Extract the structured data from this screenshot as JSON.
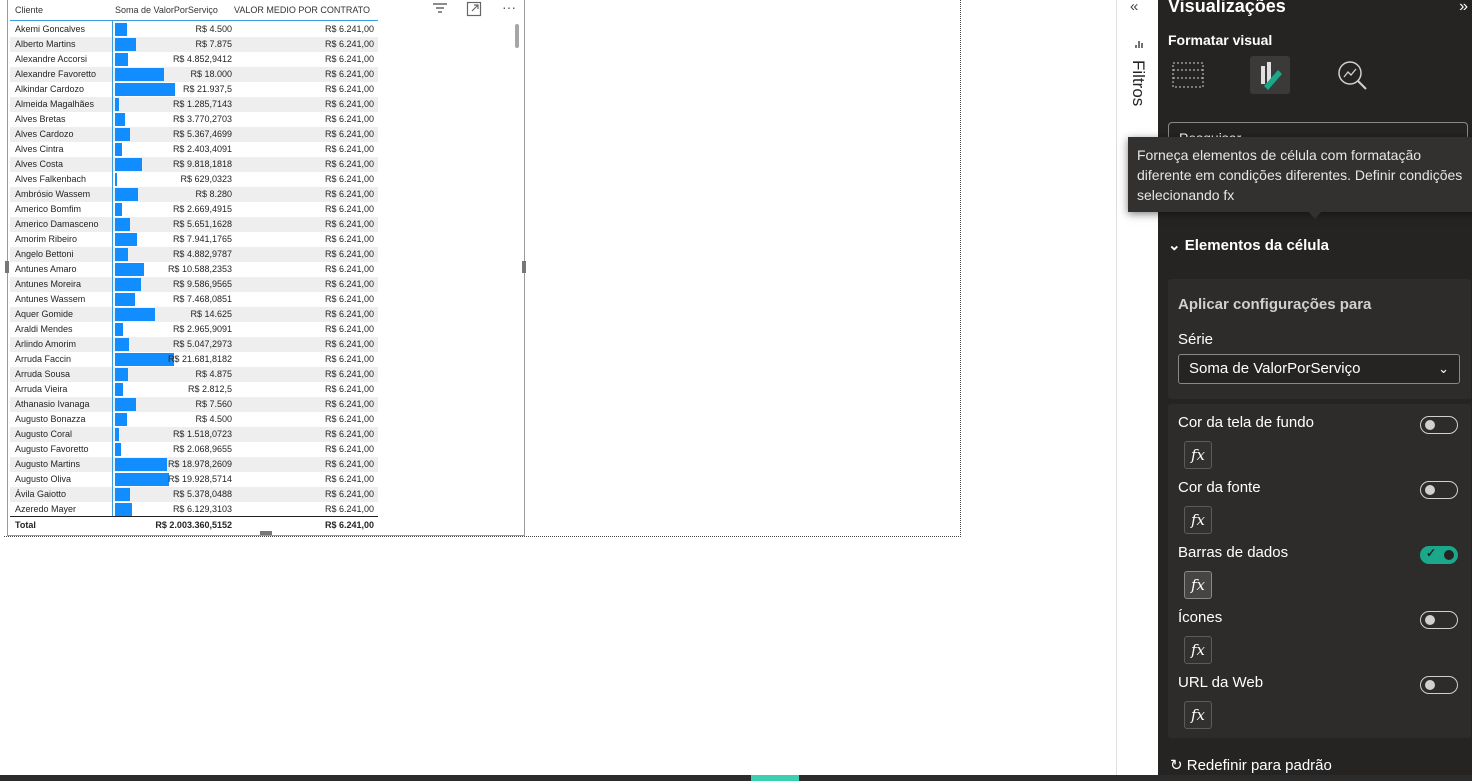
{
  "table": {
    "headers": {
      "cliente": "Cliente",
      "soma": "Soma de ValorPorServiço",
      "medio": "VALOR MEDIO POR CONTRATO"
    },
    "rows": [
      {
        "name": "Akemi Goncalves",
        "value": "R$ 4.500",
        "avg": "R$ 6.241,00",
        "bar": 4500
      },
      {
        "name": "Alberto Martins",
        "value": "R$ 7.875",
        "avg": "R$ 6.241,00",
        "bar": 7875
      },
      {
        "name": "Alexandre Accorsi",
        "value": "R$ 4.852,9412",
        "avg": "R$ 6.241,00",
        "bar": 4853
      },
      {
        "name": "Alexandre Favoretto",
        "value": "R$ 18.000",
        "avg": "R$ 6.241,00",
        "bar": 18000
      },
      {
        "name": "Alkindar Cardozo",
        "value": "R$ 21.937,5",
        "avg": "R$ 6.241,00",
        "bar": 21938
      },
      {
        "name": "Almeida Magalhães",
        "value": "R$ 1.285,7143",
        "avg": "R$ 6.241,00",
        "bar": 1286
      },
      {
        "name": "Alves Bretas",
        "value": "R$ 3.770,2703",
        "avg": "R$ 6.241,00",
        "bar": 3770
      },
      {
        "name": "Alves Cardozo",
        "value": "R$ 5.367,4699",
        "avg": "R$ 6.241,00",
        "bar": 5367
      },
      {
        "name": "Alves Cintra",
        "value": "R$ 2.403,4091",
        "avg": "R$ 6.241,00",
        "bar": 2403
      },
      {
        "name": "Alves Costa",
        "value": "R$ 9.818,1818",
        "avg": "R$ 6.241,00",
        "bar": 9818
      },
      {
        "name": "Alves Falkenbach",
        "value": "R$ 629,0323",
        "avg": "R$ 6.241,00",
        "bar": 629
      },
      {
        "name": "Ambrósio Wassem",
        "value": "R$ 8.280",
        "avg": "R$ 6.241,00",
        "bar": 8280
      },
      {
        "name": "Americo Bomfim",
        "value": "R$ 2.669,4915",
        "avg": "R$ 6.241,00",
        "bar": 2669
      },
      {
        "name": "Americo Damasceno",
        "value": "R$ 5.651,1628",
        "avg": "R$ 6.241,00",
        "bar": 5651
      },
      {
        "name": "Amorim Ribeiro",
        "value": "R$ 7.941,1765",
        "avg": "R$ 6.241,00",
        "bar": 7941
      },
      {
        "name": "Angelo Bettoni",
        "value": "R$ 4.882,9787",
        "avg": "R$ 6.241,00",
        "bar": 4883
      },
      {
        "name": "Antunes Amaro",
        "value": "R$ 10.588,2353",
        "avg": "R$ 6.241,00",
        "bar": 10588
      },
      {
        "name": "Antunes Moreira",
        "value": "R$ 9.586,9565",
        "avg": "R$ 6.241,00",
        "bar": 9587
      },
      {
        "name": "Antunes Wassem",
        "value": "R$ 7.468,0851",
        "avg": "R$ 6.241,00",
        "bar": 7468
      },
      {
        "name": "Aquer Gomide",
        "value": "R$ 14.625",
        "avg": "R$ 6.241,00",
        "bar": 14625
      },
      {
        "name": "Araldi Mendes",
        "value": "R$ 2.965,9091",
        "avg": "R$ 6.241,00",
        "bar": 2966
      },
      {
        "name": "Arlindo Amorim",
        "value": "R$ 5.047,2973",
        "avg": "R$ 6.241,00",
        "bar": 5047
      },
      {
        "name": "Arruda Faccin",
        "value": "R$ 21.681,8182",
        "avg": "R$ 6.241,00",
        "bar": 21682
      },
      {
        "name": "Arruda Sousa",
        "value": "R$ 4.875",
        "avg": "R$ 6.241,00",
        "bar": 4875
      },
      {
        "name": "Arruda Vieira",
        "value": "R$ 2.812,5",
        "avg": "R$ 6.241,00",
        "bar": 2813
      },
      {
        "name": "Athanasio Ivanaga",
        "value": "R$ 7.560",
        "avg": "R$ 6.241,00",
        "bar": 7560
      },
      {
        "name": "Augusto Bonazza",
        "value": "R$ 4.500",
        "avg": "R$ 6.241,00",
        "bar": 4500
      },
      {
        "name": "Augusto Coral",
        "value": "R$ 1.518,0723",
        "avg": "R$ 6.241,00",
        "bar": 1518
      },
      {
        "name": "Augusto Favoretto",
        "value": "R$ 2.068,9655",
        "avg": "R$ 6.241,00",
        "bar": 2069
      },
      {
        "name": "Augusto Martins",
        "value": "R$ 18.978,2609",
        "avg": "R$ 6.241,00",
        "bar": 18978
      },
      {
        "name": "Augusto Oliva",
        "value": "R$ 19.928,5714",
        "avg": "R$ 6.241,00",
        "bar": 19929
      },
      {
        "name": "Ávila Gaiotto",
        "value": "R$ 5.378,0488",
        "avg": "R$ 6.241,00",
        "bar": 5378
      },
      {
        "name": "Azeredo Mayer",
        "value": "R$ 6.129,3103",
        "avg": "R$ 6.241,00",
        "bar": 6129
      }
    ],
    "bar_max": 22000,
    "bar_color": "#118dff",
    "total": {
      "label": "Total",
      "value": "R$ 2.003.360,5152",
      "avg": "R$ 6.241,00"
    }
  },
  "filters": {
    "label": "Filtros"
  },
  "viz": {
    "title": "Visualizações",
    "format_title": "Formatar visual",
    "search_placeholder": "Pesquisar",
    "tooltip": "Forneça elementos de célula com formatação diferente em condições diferentes. Definir condições selecionando fx",
    "section_title": "Elementos da célula",
    "apply_label": "Aplicar configurações para",
    "serie_label": "Série",
    "serie_value": "Soma de ValorPorServiço",
    "options": [
      {
        "label": "Cor da tela de fundo",
        "on": false
      },
      {
        "label": "Cor da fonte",
        "on": false
      },
      {
        "label": "Barras de dados",
        "on": true
      },
      {
        "label": "Ícones",
        "on": false
      },
      {
        "label": "URL da Web",
        "on": false
      }
    ],
    "fx_label": "fx",
    "reset_label": "Redefinir para padrão",
    "accent_color": "#1aa78a"
  }
}
